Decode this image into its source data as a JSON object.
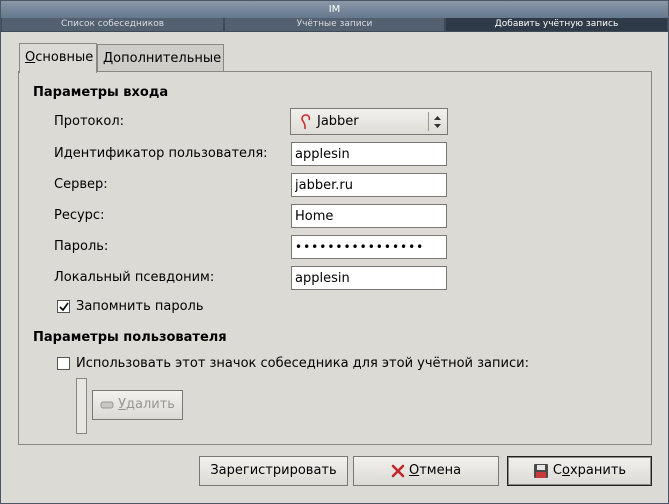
{
  "window": {
    "title": "IM"
  },
  "window_tabs": [
    {
      "label": "Список собеседников",
      "active": false
    },
    {
      "label": "Учётные записи",
      "active": false
    },
    {
      "label": "Добавить учётную запись",
      "active": true
    }
  ],
  "notebook_tabs": [
    {
      "label_underlined": "О",
      "label_rest": "сновные",
      "active": true
    },
    {
      "label_underlined": "Д",
      "label_rest": "ополнительные",
      "active": false
    }
  ],
  "login_section": {
    "title": "Параметры входа",
    "protocol": {
      "label": "Протокол:",
      "value": "Jabber",
      "icon": "jabber-bulb-icon"
    },
    "username": {
      "label": "Идентификатор пользователя:",
      "value": "applesin"
    },
    "server": {
      "label": "Сервер:",
      "value": "jabber.ru"
    },
    "resource": {
      "label": "Ресурс:",
      "value": "Home"
    },
    "password": {
      "label": "Пароль:",
      "value": "••••••••••••••••"
    },
    "alias": {
      "label": "Локальный псевдоним:",
      "value": "applesin"
    },
    "remember_password": {
      "label": "Запомнить пароль",
      "checked": true
    }
  },
  "user_section": {
    "title": "Параметры пользователя",
    "use_buddy_icon": {
      "label": "Использовать этот значок собеседника для этой учётной записи:",
      "checked": false
    },
    "remove_button": {
      "label_underlined": "У",
      "label_rest": "далить",
      "enabled": false
    }
  },
  "buttons": {
    "register": "Зарегистрировать",
    "cancel_underlined": "О",
    "cancel_rest": "тмена",
    "save_prefix": "С",
    "save_underlined": "о",
    "save_rest": "хранить"
  },
  "colors": {
    "desktop": "#6e7b8b",
    "dialog_bg": "#dcdad5",
    "active_tab": "#2e3a48",
    "cancel_icon": "#c0262b"
  }
}
